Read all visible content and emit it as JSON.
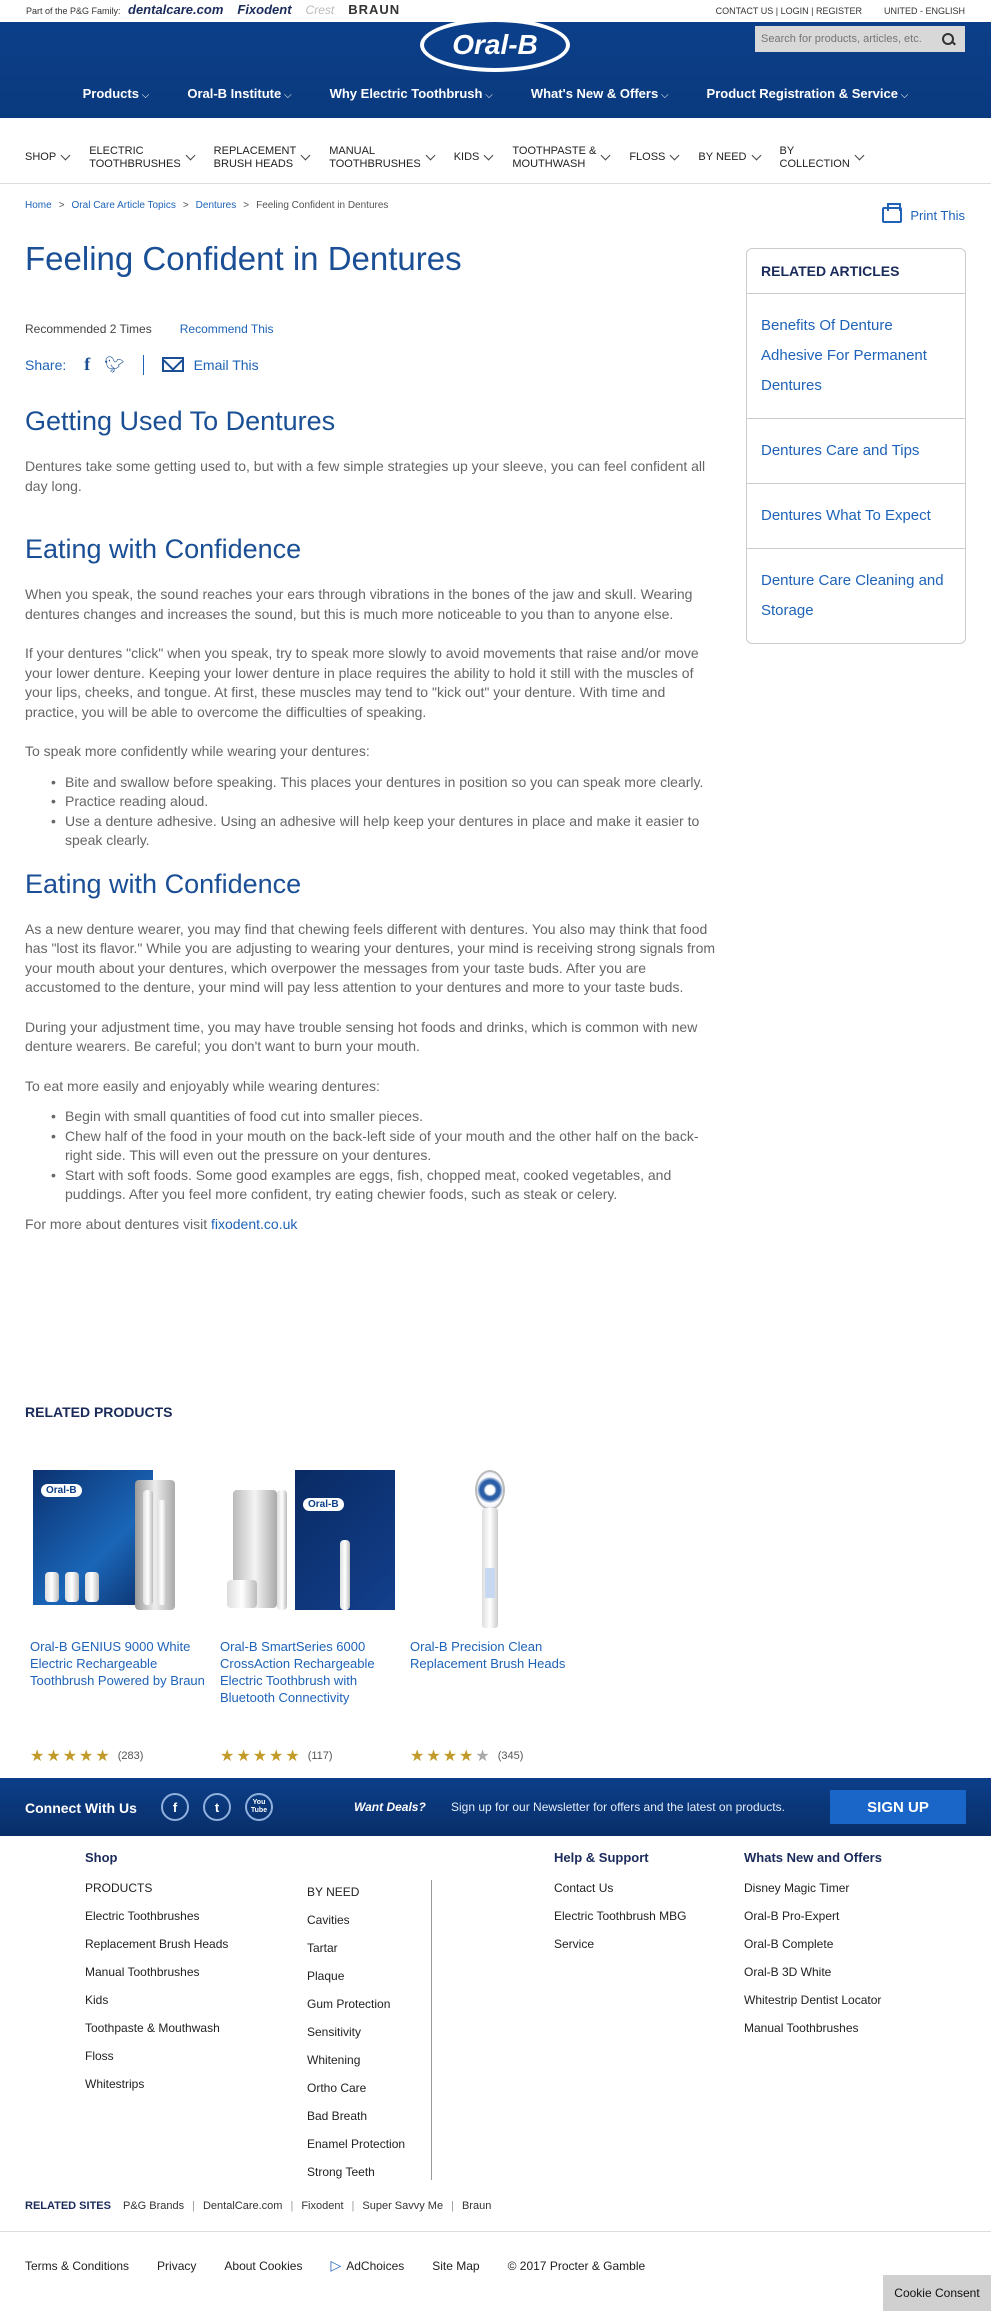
{
  "util": {
    "pg_family": "Part of the P&G Family:",
    "brands": [
      "dentalcare.com",
      "Fixodent",
      "Crest",
      "BRAUN"
    ],
    "contact": "CONTACT US",
    "login": "LOGIN",
    "register": "REGISTER",
    "region": "UNITED - ENGLISH"
  },
  "header": {
    "logo": "Oral-B",
    "search_placeholder": "Search for products, articles, etc.",
    "nav": [
      "Products",
      "Oral-B Institute",
      "Why Electric Toothbrush",
      "What's New & Offers",
      "Product Registration & Service"
    ]
  },
  "subnav": [
    {
      "l1": "SHOP",
      "l2": ""
    },
    {
      "l1": "ELECTRIC",
      "l2": "TOOTHBRUSHES"
    },
    {
      "l1": "REPLACEMENT",
      "l2": "BRUSH HEADS"
    },
    {
      "l1": "MANUAL",
      "l2": "TOOTHBRUSHES"
    },
    {
      "l1": "KIDS",
      "l2": ""
    },
    {
      "l1": "TOOTHPASTE &",
      "l2": "MOUTHWASH"
    },
    {
      "l1": "FLOSS",
      "l2": ""
    },
    {
      "l1": "BY NEED",
      "l2": ""
    },
    {
      "l1": "BY",
      "l2": "COLLECTION"
    }
  ],
  "breadcrumb": [
    "Home",
    "Oral Care Article Topics",
    "Dentures",
    "Feeling Confident in Dentures"
  ],
  "print": "Print This",
  "article": {
    "title": "Feeling Confident in Dentures",
    "recommended": "Recommended 2 Times",
    "recommend_link": "Recommend This",
    "share": "Share:",
    "email": "Email This",
    "h_used": "Getting Used To Dentures",
    "p_used": "Dentures take some getting used to, but with a few simple strategies up your sleeve, you can feel confident all day long.",
    "h_eat1": "Eating with Confidence",
    "p1": "When you speak, the sound reaches your ears through vibrations in the bones of the jaw and skull. Wearing dentures changes and increases the sound, but this is much more noticeable to you than to anyone else.",
    "p2": "If your dentures \"click\" when you speak, try to speak more slowly to avoid movements that raise and/or move your lower denture. Keeping your lower denture in place requires the ability to hold it still with the muscles of your lips, cheeks, and tongue. At first, these muscles may tend to \"kick out\" your denture. With time and practice, you will be able to overcome the difficulties of speaking.",
    "p3": "To speak more confidently while wearing your dentures:",
    "list1": [
      "Bite and swallow before speaking. This places your dentures in position so you can speak more clearly.",
      "Practice reading aloud.",
      "Use a denture adhesive. Using an adhesive will help keep your dentures in place and make it easier to speak clearly."
    ],
    "h_eat2": "Eating with Confidence",
    "p4": "As a new denture wearer, you may find that chewing feels different with dentures. You also may think that food has \"lost its flavor.\" While you are adjusting to wearing your dentures, your mind is receiving strong signals from your mouth about your dentures, which overpower the messages from your taste buds. After you are accustomed to the denture, your mind will pay less attention to your dentures and more to your taste buds.",
    "p5": "During your adjustment time, you may have trouble sensing hot foods and drinks, which is common with new denture wearers. Be careful; you don't want to burn your mouth.",
    "p6": "To eat more easily and enjoyably while wearing dentures:",
    "list2": [
      "Begin with small quantities of food cut into smaller pieces.",
      "Chew half of the food in your mouth on the back-left side of your mouth and the other half on the back-right side. This will even out the pressure on your dentures.",
      "Start with soft foods. Some good examples are eggs, fish, chopped meat, cooked vegetables, and puddings. After you feel more confident, try eating chewier foods, such as steak or celery."
    ],
    "more_prefix": "For more about dentures visit ",
    "more_link": "fixodent.co.uk"
  },
  "related_articles": {
    "title": "RELATED ARTICLES",
    "items": [
      "Benefits Of Denture Adhesive For Permanent Dentures",
      "Dentures Care and Tips",
      "Dentures What To Expect",
      "Denture Care Cleaning and Storage"
    ]
  },
  "related_products": {
    "title": "RELATED PRODUCTS",
    "items": [
      {
        "name": "Oral-B GENIUS 9000 White Electric Rechargeable Toothbrush Powered by Braun",
        "rating": 5,
        "count": "(283)"
      },
      {
        "name": "Oral-B SmartSeries 6000 CrossAction Rechargeable Electric Toothbrush with Bluetooth Connectivity",
        "rating": 5,
        "count": "(117)"
      },
      {
        "name": "Oral-B Precision Clean Replacement Brush Heads",
        "rating": 4,
        "count": "(345)"
      }
    ]
  },
  "connect": {
    "label": "Connect With Us",
    "social": [
      "f",
      "t",
      "You Tube"
    ],
    "want_deals": "Want Deals?",
    "newsletter": "Sign up for our Newsletter for offers and the latest on products.",
    "signup": "SIGN UP"
  },
  "footer": {
    "shop_title": "Shop",
    "products": [
      "PRODUCTS",
      "Electric Toothbrushes",
      "Replacement Brush Heads",
      "Manual Toothbrushes",
      "Kids",
      "Toothpaste & Mouthwash",
      "Floss",
      "Whitestrips"
    ],
    "by_need": [
      "BY NEED",
      "Cavities",
      "Tartar",
      "Plaque",
      "Gum Protection",
      "Sensitivity",
      "Whitening",
      "Ortho Care",
      "Bad Breath",
      "Enamel Protection",
      "Strong Teeth"
    ],
    "help_title": "Help & Support",
    "help": [
      "Contact Us",
      "Electric Toothbrush MBG",
      "Service"
    ],
    "new_title": "Whats New and Offers",
    "new": [
      "Disney Magic Timer",
      "Oral-B Pro-Expert",
      "Oral-B Complete",
      "Oral-B 3D White",
      "Whitestrip Dentist Locator",
      "Manual Toothbrushes"
    ],
    "related_sites_label": "RELATED SITES",
    "related_sites": [
      "P&G Brands",
      "DentalCare.com",
      "Fixodent",
      "Super Savvy Me",
      "Braun"
    ],
    "legal": [
      "Terms & Conditions",
      "Privacy",
      "About Cookies",
      "AdChoices",
      "Site Map",
      "© 2017 Procter & Gamble"
    ]
  },
  "cookie": "Cookie Consent"
}
